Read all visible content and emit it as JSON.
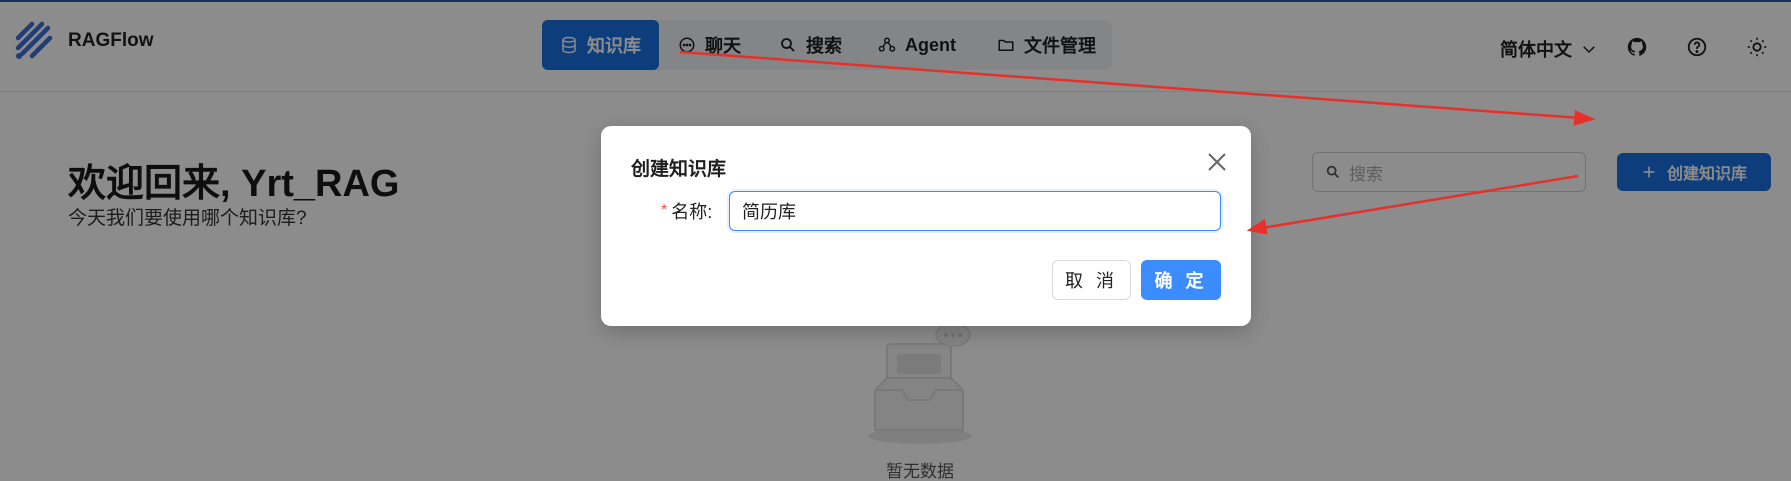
{
  "app": {
    "brand": "RAGFlow"
  },
  "nav": {
    "items": [
      {
        "label": "知识库",
        "icon": "database-icon",
        "active": true
      },
      {
        "label": "聊天",
        "icon": "chat-icon",
        "active": false
      },
      {
        "label": "搜索",
        "icon": "search-icon",
        "active": false
      },
      {
        "label": "Agent",
        "icon": "agent-icon",
        "active": false
      },
      {
        "label": "文件管理",
        "icon": "folder-icon",
        "active": false
      }
    ]
  },
  "header": {
    "language": "简体中文"
  },
  "main": {
    "welcome": "欢迎回来, Yrt_RAG",
    "subtitle": "今天我们要使用哪个知识库?",
    "search_placeholder": "搜索",
    "create_button": "创建知识库",
    "empty_text": "暂无数据"
  },
  "modal": {
    "title": "创建知识库",
    "name_label": "名称:",
    "name_value": "简历库",
    "cancel_label": "取 消",
    "ok_label": "确 定"
  },
  "colors": {
    "primary": "#1a6fe0",
    "ok_button": "#3b8cff",
    "required": "#ff4d4f",
    "annotation_arrow": "#e8302a"
  }
}
